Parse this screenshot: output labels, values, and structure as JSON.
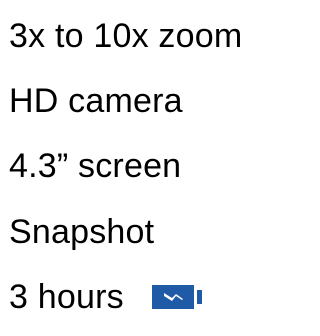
{
  "features": [
    {
      "label": "3x to 10x zoom"
    },
    {
      "label": "HD camera"
    },
    {
      "label": "4.3” screen"
    },
    {
      "label": "Snapshot"
    },
    {
      "label": "3 hours",
      "icon": "battery-charging-icon"
    }
  ],
  "colors": {
    "text": "#000000",
    "battery_body": "#1f5aa6",
    "battery_bolt": "#ffffff",
    "background": "#ffffff"
  }
}
